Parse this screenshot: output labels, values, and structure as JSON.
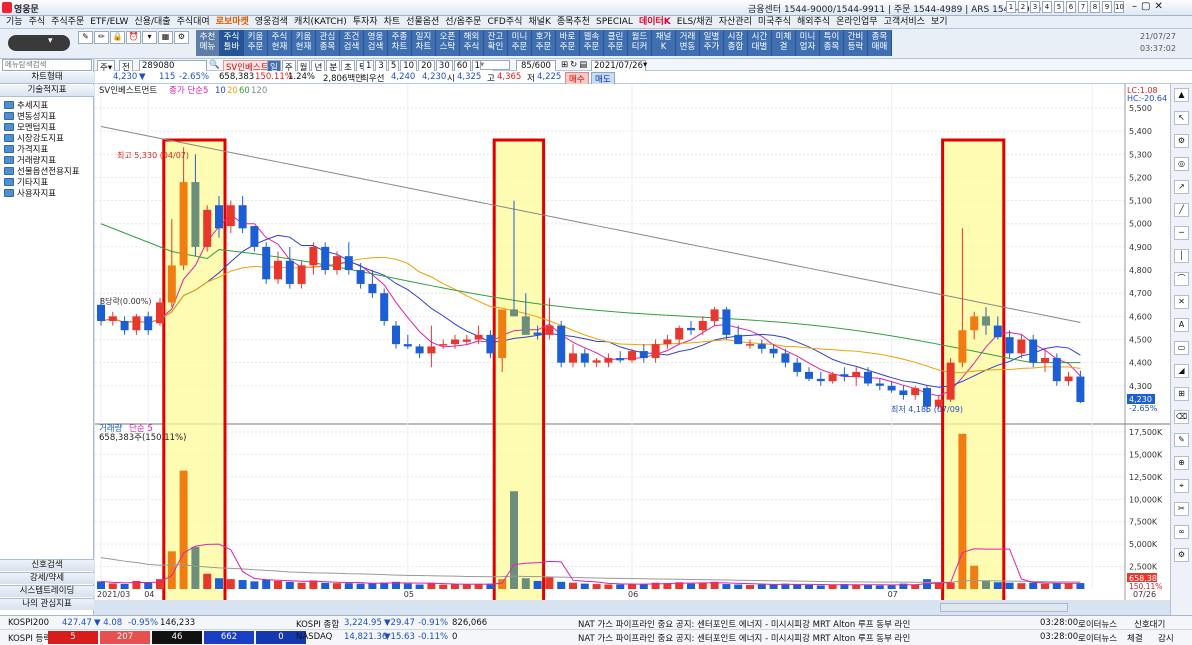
{
  "app": {
    "title": "영웅문",
    "centers": "금융센터 1544-9000/1544-9911 | 주문 1544-4989 | ARS 1544-9900",
    "page_numbers": [
      "1",
      "2",
      "3",
      "4",
      "5",
      "6",
      "7",
      "8",
      "9",
      "10"
    ]
  },
  "menu": {
    "items": [
      "기능",
      "주식",
      "주식주문",
      "ETF/ELW",
      "신용/대출",
      "주식대여",
      "로보마켓",
      "영웅검색",
      "캐치(KATCH)",
      "투자자",
      "차트",
      "선물옵션",
      "선/옵주문",
      "CFD주식",
      "채널K",
      "종목추천",
      "SPECIAL",
      "데이터K",
      "ELS/채권",
      "자산관리",
      "미국주식",
      "해외주식",
      "온라인업무",
      "고객서비스",
      "보기"
    ],
    "red_items": [
      "로보마켓",
      "데이터K"
    ]
  },
  "toolbar": {
    "buttons": [
      "추천\n메뉴",
      "주식\n툴바",
      "키움\n주문",
      "주식\n현재",
      "키움\n현재",
      "관심\n종목",
      "조건\n검색",
      "영웅\n검색",
      "주종\n차트",
      "일지\n차트",
      "오픈\n스탁",
      "해외\n주식",
      "잔고\n확인",
      "미니\n주문",
      "호가\n주문",
      "바로\n주문",
      "웹속\n주문",
      "클린\n주문",
      "월드\n티커",
      "채널\nK",
      "거래\n변동",
      "일별\n주가",
      "시장\n종합",
      "시간\n대별",
      "미체\n결",
      "미니\n업자",
      "특이\n종목",
      "간비\n등락",
      "종목\n매매"
    ],
    "date": "21/07/27",
    "time": "03:37:02"
  },
  "left_panel": {
    "search_placeholder": "메뉴탐색검색",
    "chart_type_header": "차트형태",
    "tech_header": "기술적지표",
    "tree": [
      "추세지표",
      "변동성지표",
      "모멘텀지표",
      "시장강도지표",
      "가격지표",
      "거래량지표",
      "선물옵션전용지표",
      "기타지표",
      "사용자지표"
    ],
    "bottom": [
      "신호검색",
      "강세/약세",
      "시스템트레이딩",
      "나의 관심지표"
    ]
  },
  "controls": {
    "code": "289080",
    "name": "SV인베스트",
    "periods": [
      "일",
      "주",
      "월",
      "년",
      "분",
      "초",
      "틱"
    ],
    "minutes": [
      "1",
      "3",
      "5",
      "10",
      "20",
      "30",
      "60",
      "120"
    ],
    "count": "85/600",
    "date": "2021/07/26"
  },
  "quote": {
    "price": "4,230",
    "change": "115",
    "pct": "-2.65%",
    "volume": "658,383",
    "vol_pct": "150.11%",
    "turnover_ratio": "1.24%",
    "amount": "2,806백만",
    "pref": "최우선",
    "bid": "4,240",
    "ask": "4,230",
    "open_label": "시",
    "open": "4,325",
    "high_label": "고",
    "high": "4,365",
    "low_label": "저",
    "low": "4,225",
    "buy": "매수",
    "sell": "매도"
  },
  "chart_data": {
    "type": "candlestick",
    "legend_price": "SV인베스트먼트",
    "legend_ma": "종가 단순",
    "ma_periods": [
      "5",
      "10",
      "20",
      "60",
      "120"
    ],
    "legend_volume": "거래량",
    "legend_volume_ma": "단순 5",
    "volume_label": "658,383주(150.11%)",
    "lc": "LC:1.08",
    "hc": "HC:-20.64",
    "high_ann": "최고 5,330 (04/07)",
    "low_ann": "최저 4,185 (07/09)",
    "left_ann": "8당락(0.00%)",
    "last_price_tag": "4,230",
    "last_pct_tag": "-2.65%",
    "last_vol_tag": "658,383",
    "last_vol_pct": "150.11%",
    "price_axis": [
      "5,500",
      "5,400",
      "5,300",
      "5,200",
      "5,100",
      "5,000",
      "4,900",
      "4,800",
      "4,700",
      "4,600",
      "4,500",
      "4,400",
      "4,300"
    ],
    "price_axis_vals": [
      5500,
      5400,
      5300,
      5200,
      5100,
      5000,
      4900,
      4800,
      4700,
      4600,
      4500,
      4400,
      4300
    ],
    "vol_axis": [
      "17,500K",
      "15,000K",
      "12,500K",
      "10,000K",
      "7,500K",
      "5,000K",
      "2,500K"
    ],
    "vol_axis_vals": [
      17500,
      15000,
      12500,
      10000,
      7500,
      5000,
      2500
    ],
    "x_labels": [
      "2021/03",
      "04",
      "05",
      "06",
      "07",
      "07/26"
    ],
    "x_label_index": [
      0,
      4,
      26,
      45,
      67,
      84
    ],
    "candles": [
      [
        4650,
        4680,
        4560,
        4580
      ],
      [
        4580,
        4620,
        4560,
        4600
      ],
      [
        4580,
        4600,
        4520,
        4540
      ],
      [
        4540,
        4610,
        4520,
        4600
      ],
      [
        4600,
        4620,
        4520,
        4540
      ],
      [
        4570,
        4680,
        4560,
        4660
      ],
      [
        4660,
        5020,
        4640,
        4820
      ],
      [
        4820,
        5330,
        4800,
        5180
      ],
      [
        5180,
        5300,
        4860,
        4900
      ],
      [
        4900,
        5080,
        4880,
        5060
      ],
      [
        5080,
        5120,
        4940,
        4980
      ],
      [
        4990,
        5100,
        4960,
        5080
      ],
      [
        5080,
        5120,
        4960,
        4980
      ],
      [
        4990,
        4990,
        4880,
        4900
      ],
      [
        4900,
        4920,
        4740,
        4760
      ],
      [
        4760,
        4880,
        4740,
        4840
      ],
      [
        4840,
        4900,
        4720,
        4740
      ],
      [
        4740,
        4840,
        4720,
        4820
      ],
      [
        4820,
        4920,
        4780,
        4900
      ],
      [
        4900,
        4920,
        4780,
        4800
      ],
      [
        4800,
        4880,
        4780,
        4860
      ],
      [
        4860,
        4920,
        4780,
        4800
      ],
      [
        4800,
        4830,
        4720,
        4740
      ],
      [
        4740,
        4800,
        4680,
        4700
      ],
      [
        4700,
        4720,
        4560,
        4580
      ],
      [
        4560,
        4580,
        4460,
        4480
      ],
      [
        4480,
        4520,
        4460,
        4470
      ],
      [
        4470,
        4480,
        4420,
        4440
      ],
      [
        4440,
        4560,
        4380,
        4470
      ],
      [
        4480,
        4500,
        4460,
        4480
      ],
      [
        4480,
        4520,
        4460,
        4500
      ],
      [
        4490,
        4520,
        4480,
        4500
      ],
      [
        4500,
        4560,
        4480,
        4520
      ],
      [
        4520,
        4540,
        4420,
        4440
      ],
      [
        4420,
        4620,
        4360,
        4630
      ],
      [
        4630,
        5100,
        4620,
        4600
      ],
      [
        4600,
        4700,
        4560,
        4520
      ],
      [
        4530,
        4560,
        4500,
        4520
      ],
      [
        4520,
        4680,
        4500,
        4560
      ],
      [
        4560,
        4580,
        4380,
        4400
      ],
      [
        4400,
        4480,
        4380,
        4440
      ],
      [
        4440,
        4460,
        4380,
        4400
      ],
      [
        4400,
        4420,
        4380,
        4410
      ],
      [
        4400,
        4440,
        4380,
        4420
      ],
      [
        4420,
        4450,
        4400,
        4410
      ],
      [
        4410,
        4460,
        4400,
        4450
      ],
      [
        4450,
        4480,
        4400,
        4420
      ],
      [
        4420,
        4500,
        4400,
        4480
      ],
      [
        4480,
        4520,
        4460,
        4500
      ],
      [
        4500,
        4560,
        4480,
        4550
      ],
      [
        4550,
        4580,
        4520,
        4540
      ],
      [
        4540,
        4600,
        4520,
        4580
      ],
      [
        4580,
        4640,
        4560,
        4630
      ],
      [
        4630,
        4640,
        4500,
        4520
      ],
      [
        4520,
        4560,
        4480,
        4480
      ],
      [
        4480,
        4500,
        4460,
        4480
      ],
      [
        4480,
        4500,
        4440,
        4460
      ],
      [
        4460,
        4480,
        4420,
        4440
      ],
      [
        4440,
        4460,
        4380,
        4400
      ],
      [
        4400,
        4420,
        4340,
        4360
      ],
      [
        4360,
        4380,
        4320,
        4330
      ],
      [
        4330,
        4360,
        4300,
        4320
      ],
      [
        4320,
        4360,
        4310,
        4350
      ],
      [
        4350,
        4380,
        4320,
        4340
      ],
      [
        4340,
        4380,
        4300,
        4360
      ],
      [
        4360,
        4380,
        4300,
        4310
      ],
      [
        4310,
        4330,
        4280,
        4300
      ],
      [
        4300,
        4320,
        4270,
        4280
      ],
      [
        4280,
        4300,
        4240,
        4260
      ],
      [
        4260,
        4300,
        4240,
        4290
      ],
      [
        4290,
        4300,
        4185,
        4210
      ],
      [
        4210,
        4260,
        4200,
        4240
      ],
      [
        4240,
        4420,
        4230,
        4400
      ],
      [
        4400,
        4980,
        4380,
        4540
      ],
      [
        4540,
        4620,
        4500,
        4600
      ],
      [
        4600,
        4640,
        4520,
        4560
      ],
      [
        4560,
        4600,
        4500,
        4510
      ],
      [
        4510,
        4540,
        4420,
        4440
      ],
      [
        4440,
        4520,
        4420,
        4500
      ],
      [
        4500,
        4520,
        4380,
        4400
      ],
      [
        4400,
        4460,
        4360,
        4420
      ],
      [
        4420,
        4440,
        4300,
        4320
      ],
      [
        4320,
        4360,
        4300,
        4340
      ],
      [
        4340,
        4365,
        4225,
        4230
      ]
    ],
    "volumes_k": [
      850,
      620,
      560,
      900,
      700,
      1100,
      4200,
      13200,
      4700,
      1700,
      1200,
      1100,
      1000,
      850,
      1050,
      900,
      800,
      700,
      950,
      680,
      650,
      650,
      600,
      650,
      720,
      800,
      600,
      500,
      650,
      480,
      550,
      500,
      520,
      600,
      1100,
      10900,
      1200,
      900,
      1300,
      800,
      700,
      600,
      550,
      500,
      500,
      600,
      550,
      700,
      650,
      750,
      600,
      700,
      800,
      550,
      500,
      450,
      500,
      550,
      600,
      500,
      450,
      400,
      450,
      550,
      500,
      450,
      400,
      420,
      600,
      500,
      1100,
      700,
      700,
      17300,
      2600,
      900,
      750,
      700,
      650,
      700,
      600,
      650,
      600,
      658
    ],
    "ma5_vol": [
      3500,
      3300,
      3100,
      2950,
      2750,
      2650,
      2700,
      2700,
      2550,
      2450,
      2350,
      2300,
      2250,
      2150,
      2080,
      1990,
      1900,
      1850,
      1800,
      1780,
      1750,
      1700,
      1680,
      1650,
      1600,
      1550,
      1520,
      1500,
      1470,
      1450,
      1430,
      1400,
      1380,
      1360,
      1380,
      1430,
      1400,
      1380,
      1350,
      1320,
      1300,
      1260,
      1220,
      1200,
      1180,
      1160,
      1140,
      1120,
      1100,
      1080,
      1060,
      1040,
      1020,
      1000,
      980,
      960,
      940,
      920,
      900,
      880,
      860,
      840,
      820,
      800,
      790,
      780,
      770,
      760,
      760,
      750,
      740,
      740,
      740,
      900,
      950,
      920,
      900,
      880,
      860,
      840,
      820,
      800,
      790,
      780
    ]
  },
  "status": {
    "kospi200_label": "KOSPI200",
    "kospi200": "427.47",
    "kospi200_chg": "▼ 4.08",
    "kospi200_pct": "-0.95%",
    "kospi200_vol": "146,233",
    "kospi_comp_label": "KOSPI 종합",
    "kospi_comp": "3,224.95",
    "kospi_comp_chg": "▼29.47",
    "kospi_comp_pct": "-0.91%",
    "kospi_comp_vol": "826,066",
    "nasdaq_label": "NASDAQ",
    "nasdaq": "14,821.36",
    "nasdaq_chg": "▼15.63",
    "nasdaq_pct": "-0.11%",
    "nasdaq_vol": "0",
    "kospi_rise_label": "KOSPI 등락",
    "rise_vals": [
      "5",
      "207",
      "46",
      "662",
      "0"
    ],
    "news1": "NAT 가스 파이프라인 중요 공지: 센터포인트 에너지 - 미시시피강 MRT Alton 루프 동부 라인",
    "news2": "NAT 가스 파이프라인 중요 공지: 센터포인트 에너지 - 미시시피강 MRT Alton 루프 동부 라인",
    "news_time": "03:28:00",
    "news_src": "로이터뉴스",
    "signal": "신호대기",
    "order": "체결",
    "watch": "감시"
  }
}
